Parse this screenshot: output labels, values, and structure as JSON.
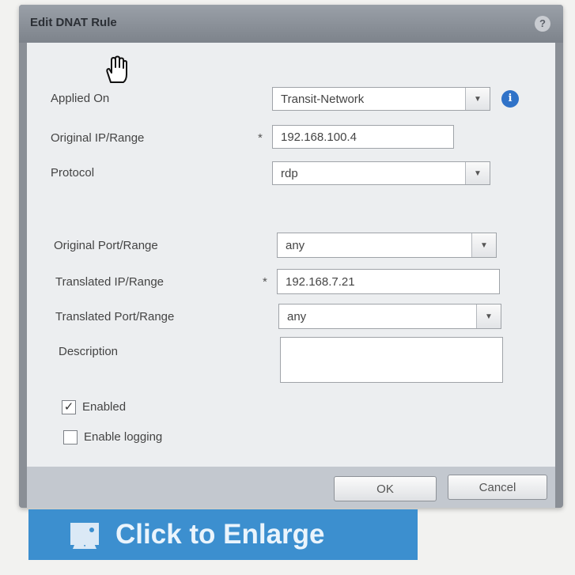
{
  "dialog": {
    "title": "Edit DNAT Rule",
    "help_label": "?"
  },
  "form": {
    "applied_on": {
      "label": "Applied On",
      "value": "Transit-Network"
    },
    "info_icon": "i",
    "original_ip": {
      "label": "Original IP/Range",
      "required_mark": "*",
      "value": "192.168.100.4"
    },
    "protocol": {
      "label": "Protocol",
      "value": "rdp"
    },
    "original_port": {
      "label": "Original Port/Range",
      "value": "any"
    },
    "translated_ip": {
      "label": "Translated IP/Range",
      "required_mark": "*",
      "value": "192.168.7.21"
    },
    "translated_port": {
      "label": "Translated Port/Range",
      "value": "any"
    },
    "description": {
      "label": "Description",
      "value": ""
    },
    "enabled": {
      "label": "Enabled",
      "checked": true,
      "check_glyph": "✓"
    },
    "enable_logging": {
      "label": "Enable logging",
      "checked": false
    }
  },
  "buttons": {
    "ok": "OK",
    "cancel": "Cancel"
  },
  "banner": {
    "text": "Click to Enlarge"
  },
  "icons": {
    "cursor": "hand-cursor-icon",
    "dropdown": "chevron-down-icon",
    "info": "info-icon",
    "enlarge": "enlarge-image-icon"
  },
  "colors": {
    "banner": "#3c8fcf",
    "info_icon": "#2f72c8",
    "titlebar": "#8a8f96"
  }
}
